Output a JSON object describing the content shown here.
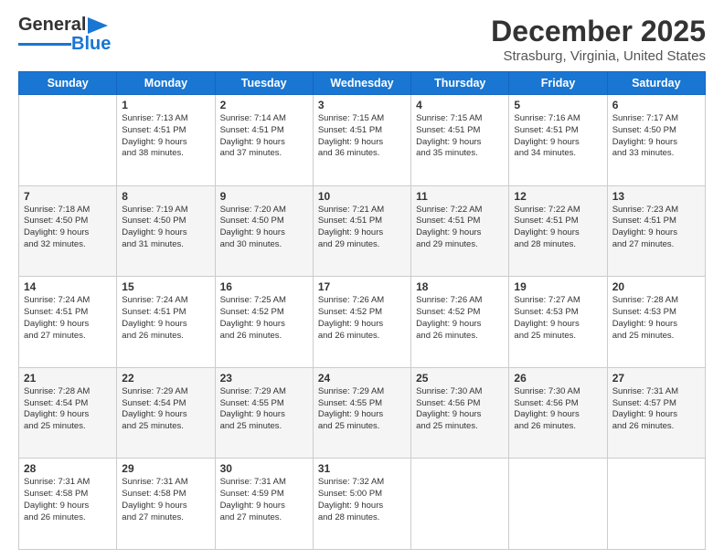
{
  "logo": {
    "line1": "General",
    "line2": "Blue"
  },
  "title": "December 2025",
  "subtitle": "Strasburg, Virginia, United States",
  "weekdays": [
    "Sunday",
    "Monday",
    "Tuesday",
    "Wednesday",
    "Thursday",
    "Friday",
    "Saturday"
  ],
  "weeks": [
    [
      {
        "num": "",
        "info": ""
      },
      {
        "num": "1",
        "info": "Sunrise: 7:13 AM\nSunset: 4:51 PM\nDaylight: 9 hours\nand 38 minutes."
      },
      {
        "num": "2",
        "info": "Sunrise: 7:14 AM\nSunset: 4:51 PM\nDaylight: 9 hours\nand 37 minutes."
      },
      {
        "num": "3",
        "info": "Sunrise: 7:15 AM\nSunset: 4:51 PM\nDaylight: 9 hours\nand 36 minutes."
      },
      {
        "num": "4",
        "info": "Sunrise: 7:15 AM\nSunset: 4:51 PM\nDaylight: 9 hours\nand 35 minutes."
      },
      {
        "num": "5",
        "info": "Sunrise: 7:16 AM\nSunset: 4:51 PM\nDaylight: 9 hours\nand 34 minutes."
      },
      {
        "num": "6",
        "info": "Sunrise: 7:17 AM\nSunset: 4:50 PM\nDaylight: 9 hours\nand 33 minutes."
      }
    ],
    [
      {
        "num": "7",
        "info": "Sunrise: 7:18 AM\nSunset: 4:50 PM\nDaylight: 9 hours\nand 32 minutes."
      },
      {
        "num": "8",
        "info": "Sunrise: 7:19 AM\nSunset: 4:50 PM\nDaylight: 9 hours\nand 31 minutes."
      },
      {
        "num": "9",
        "info": "Sunrise: 7:20 AM\nSunset: 4:50 PM\nDaylight: 9 hours\nand 30 minutes."
      },
      {
        "num": "10",
        "info": "Sunrise: 7:21 AM\nSunset: 4:51 PM\nDaylight: 9 hours\nand 29 minutes."
      },
      {
        "num": "11",
        "info": "Sunrise: 7:22 AM\nSunset: 4:51 PM\nDaylight: 9 hours\nand 29 minutes."
      },
      {
        "num": "12",
        "info": "Sunrise: 7:22 AM\nSunset: 4:51 PM\nDaylight: 9 hours\nand 28 minutes."
      },
      {
        "num": "13",
        "info": "Sunrise: 7:23 AM\nSunset: 4:51 PM\nDaylight: 9 hours\nand 27 minutes."
      }
    ],
    [
      {
        "num": "14",
        "info": "Sunrise: 7:24 AM\nSunset: 4:51 PM\nDaylight: 9 hours\nand 27 minutes."
      },
      {
        "num": "15",
        "info": "Sunrise: 7:24 AM\nSunset: 4:51 PM\nDaylight: 9 hours\nand 26 minutes."
      },
      {
        "num": "16",
        "info": "Sunrise: 7:25 AM\nSunset: 4:52 PM\nDaylight: 9 hours\nand 26 minutes."
      },
      {
        "num": "17",
        "info": "Sunrise: 7:26 AM\nSunset: 4:52 PM\nDaylight: 9 hours\nand 26 minutes."
      },
      {
        "num": "18",
        "info": "Sunrise: 7:26 AM\nSunset: 4:52 PM\nDaylight: 9 hours\nand 26 minutes."
      },
      {
        "num": "19",
        "info": "Sunrise: 7:27 AM\nSunset: 4:53 PM\nDaylight: 9 hours\nand 25 minutes."
      },
      {
        "num": "20",
        "info": "Sunrise: 7:28 AM\nSunset: 4:53 PM\nDaylight: 9 hours\nand 25 minutes."
      }
    ],
    [
      {
        "num": "21",
        "info": "Sunrise: 7:28 AM\nSunset: 4:54 PM\nDaylight: 9 hours\nand 25 minutes."
      },
      {
        "num": "22",
        "info": "Sunrise: 7:29 AM\nSunset: 4:54 PM\nDaylight: 9 hours\nand 25 minutes."
      },
      {
        "num": "23",
        "info": "Sunrise: 7:29 AM\nSunset: 4:55 PM\nDaylight: 9 hours\nand 25 minutes."
      },
      {
        "num": "24",
        "info": "Sunrise: 7:29 AM\nSunset: 4:55 PM\nDaylight: 9 hours\nand 25 minutes."
      },
      {
        "num": "25",
        "info": "Sunrise: 7:30 AM\nSunset: 4:56 PM\nDaylight: 9 hours\nand 25 minutes."
      },
      {
        "num": "26",
        "info": "Sunrise: 7:30 AM\nSunset: 4:56 PM\nDaylight: 9 hours\nand 26 minutes."
      },
      {
        "num": "27",
        "info": "Sunrise: 7:31 AM\nSunset: 4:57 PM\nDaylight: 9 hours\nand 26 minutes."
      }
    ],
    [
      {
        "num": "28",
        "info": "Sunrise: 7:31 AM\nSunset: 4:58 PM\nDaylight: 9 hours\nand 26 minutes."
      },
      {
        "num": "29",
        "info": "Sunrise: 7:31 AM\nSunset: 4:58 PM\nDaylight: 9 hours\nand 27 minutes."
      },
      {
        "num": "30",
        "info": "Sunrise: 7:31 AM\nSunset: 4:59 PM\nDaylight: 9 hours\nand 27 minutes."
      },
      {
        "num": "31",
        "info": "Sunrise: 7:32 AM\nSunset: 5:00 PM\nDaylight: 9 hours\nand 28 minutes."
      },
      {
        "num": "",
        "info": ""
      },
      {
        "num": "",
        "info": ""
      },
      {
        "num": "",
        "info": ""
      }
    ]
  ]
}
